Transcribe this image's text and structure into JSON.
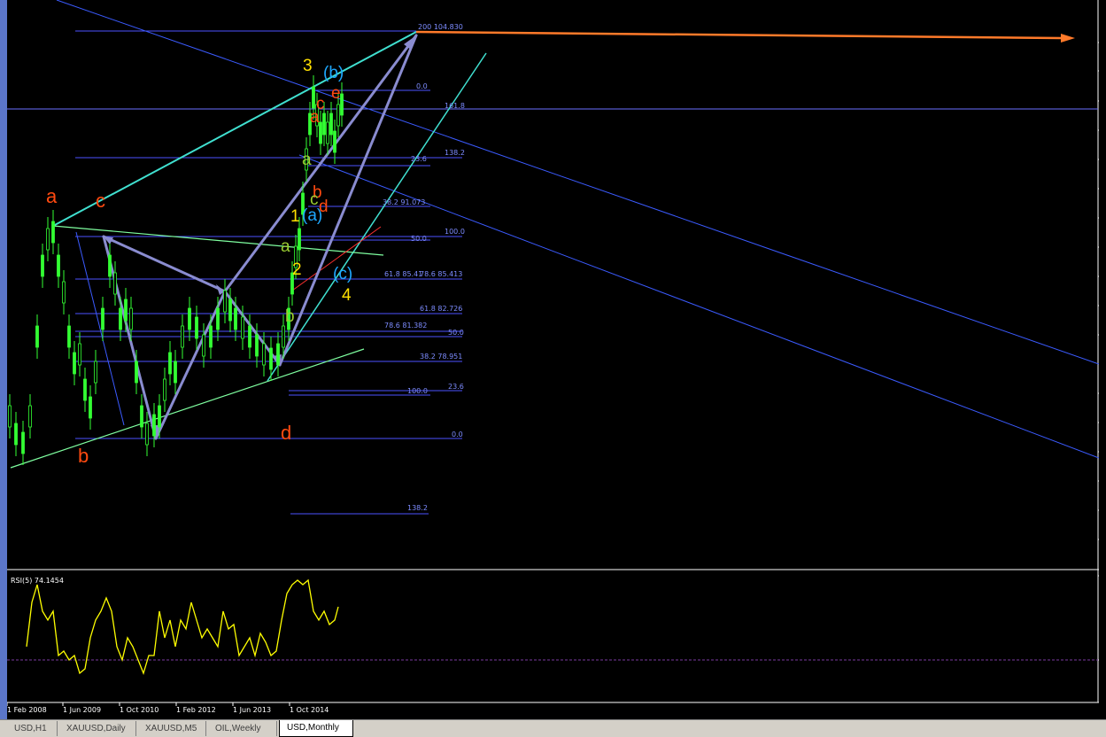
{
  "tabs": [
    {
      "label": "USD,H1",
      "active": false
    },
    {
      "label": "XAUUSD,Daily",
      "active": false
    },
    {
      "label": "XAUUSD,M5",
      "active": false
    },
    {
      "label": "OIL,Weekly",
      "active": false
    },
    {
      "label": "USD,Monthly",
      "active": true
    }
  ],
  "time_axis_labels": [
    "1 Feb 2008",
    "1 Jun 2009",
    "1 Oct 2010",
    "1 Feb 2012",
    "1 Jun 2013",
    "1 Oct 2014"
  ],
  "rsi": {
    "label": "RSI(5) 74.1454",
    "color": "#ffff00"
  },
  "fib_labels": {
    "f200": "200 104.830",
    "f0_top": "0.0",
    "f161": "161.8",
    "f138": "138.2",
    "f23_top": "23.6",
    "f38_91": "38.2 91.073",
    "f100_mid": "100.0",
    "f50_mid": "50.0",
    "f618_85": "61.8 85.41",
    "f786_85": "78.6 85.413",
    "f618_82": "61.8 82.726",
    "f786_81": "78.6 81.382",
    "f50_low": "50.0",
    "f382_78": "38.2 78.951",
    "f100_low": "100.0",
    "f236_low": "23.6",
    "f0_low": "0.0",
    "f1382_bottom": "138.2"
  },
  "wave_labels": {
    "a_orange": "a",
    "c_orange": "c",
    "b_orange": "b",
    "d_orange": "d",
    "w3": "3",
    "wb": "(b)",
    "we": "e",
    "wc": "c",
    "wa_small": "a",
    "w1": "1",
    "wa_paren": "(a)",
    "wb_small": "b",
    "wd": "d",
    "wc_small": "c",
    "wa_green": "a",
    "w2": "2",
    "wc_paren": "(c)",
    "w4": "4",
    "wb_green": "b",
    "wd_green": "a"
  },
  "colors": {
    "candle": "#33ff33",
    "fib": "#6a6fff",
    "channel": "#3b5bff",
    "cyan": "#40e0d0",
    "arrow": "#8a8cd0",
    "orange_arrow": "#ff7a2a",
    "label_orange": "#ff4a10",
    "label_yellow": "#ffe000",
    "label_cyan": "#1ea8ff",
    "label_green": "#9acd32"
  }
}
